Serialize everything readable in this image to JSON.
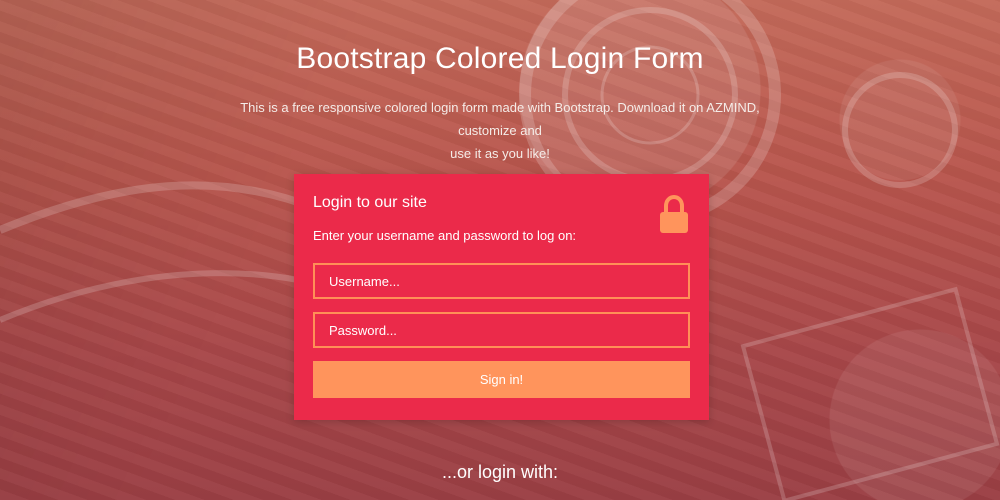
{
  "header": {
    "title": "Bootstrap Colored Login Form",
    "subtitle_line1": "This is a free responsive colored login form made with Bootstrap. Download it on AZMIND, customize and",
    "subtitle_line2": "use it as you like!"
  },
  "login_card": {
    "title": "Login to our site",
    "description": "Enter your username and password to log on:",
    "username_placeholder": "Username...",
    "password_placeholder": "Password...",
    "signin_label": "Sign in!"
  },
  "footer": {
    "alt_login": "...or login with:"
  },
  "colors": {
    "card": "#eb2a4a",
    "accent": "#ff945c"
  },
  "icons": {
    "lock": "lock-icon"
  }
}
